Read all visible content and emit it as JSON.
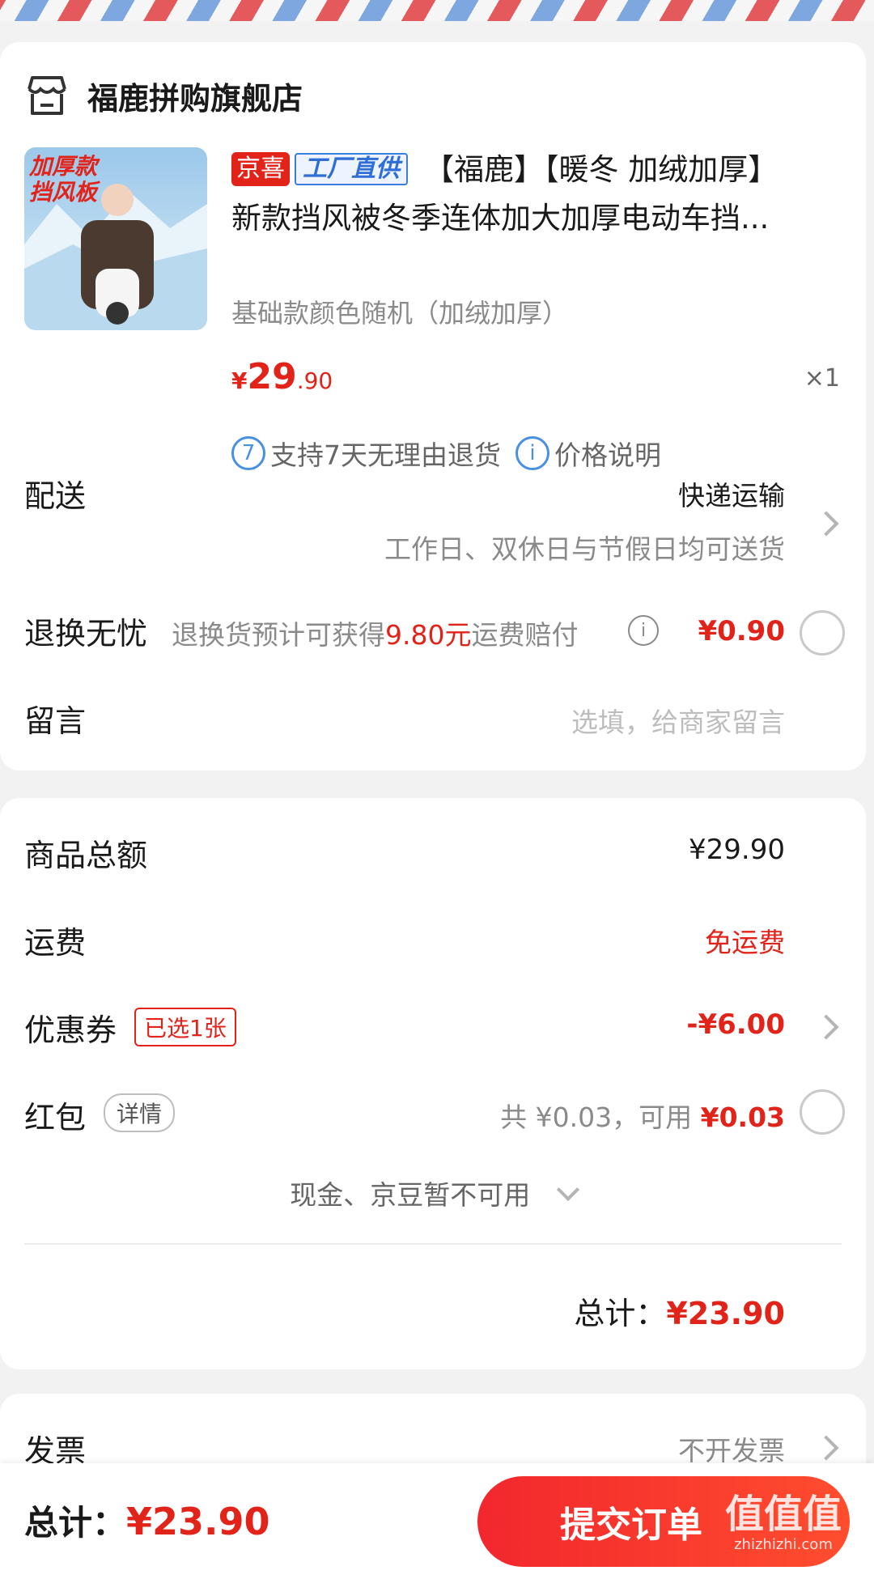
{
  "store": {
    "name": "福鹿拼购旗舰店",
    "icon": "store-icon"
  },
  "product": {
    "image_alt_text": [
      "加厚款",
      "挡风板"
    ],
    "tags": [
      "京喜",
      "工厂直供"
    ],
    "title_line1": "【福鹿】【暖冬 加绒加厚】",
    "title_line2": "新款挡风被冬季连体加大加厚电动车挡...",
    "spec": "基础款颜色随机（加绒加厚）",
    "price_currency": "¥",
    "price_int": "29",
    "price_dec": ".90",
    "qty": "×1",
    "promise_7day_icon": "7",
    "promise_7day": "支持7天无理由退货",
    "price_info_icon": "i",
    "price_info": "价格说明"
  },
  "delivery": {
    "label": "配送",
    "method": "快递运输",
    "desc": "工作日、双休日与节假日均可送货"
  },
  "return_insurance": {
    "label": "退换无忧",
    "desc_prefix": "退换货预计可获得",
    "desc_amount": "9.80元",
    "desc_suffix": "运费赔付",
    "info_icon": "i",
    "price": "¥0.90"
  },
  "message": {
    "label": "留言",
    "placeholder": "选填，给商家留言"
  },
  "summary": {
    "goods_total_label": "商品总额",
    "goods_total": "¥29.90",
    "shipping_label": "运费",
    "shipping": "免运费",
    "coupon_label": "优惠券",
    "coupon_badge": "已选1张",
    "coupon_value": "-¥6.00",
    "redpacket_label": "红包",
    "redpacket_badge": "详情",
    "redpacket_total": "共 ¥0.03，可用 ",
    "redpacket_available": "¥0.03",
    "cash_note": "现金、京豆暂不可用",
    "total_label": "总计：",
    "total": "¥23.90"
  },
  "invoice": {
    "label": "发票",
    "value": "不开发票"
  },
  "bottom": {
    "total_label": "总计：",
    "total": "¥23.90",
    "submit": "提交订单",
    "watermark": "值值值",
    "watermark_url": "zhizhizhi.com"
  },
  "colors": {
    "accent_red": "#e2231a",
    "link_blue": "#4a90e2",
    "button_gradient": [
      "#f2272d",
      "#ff4d2e"
    ]
  }
}
